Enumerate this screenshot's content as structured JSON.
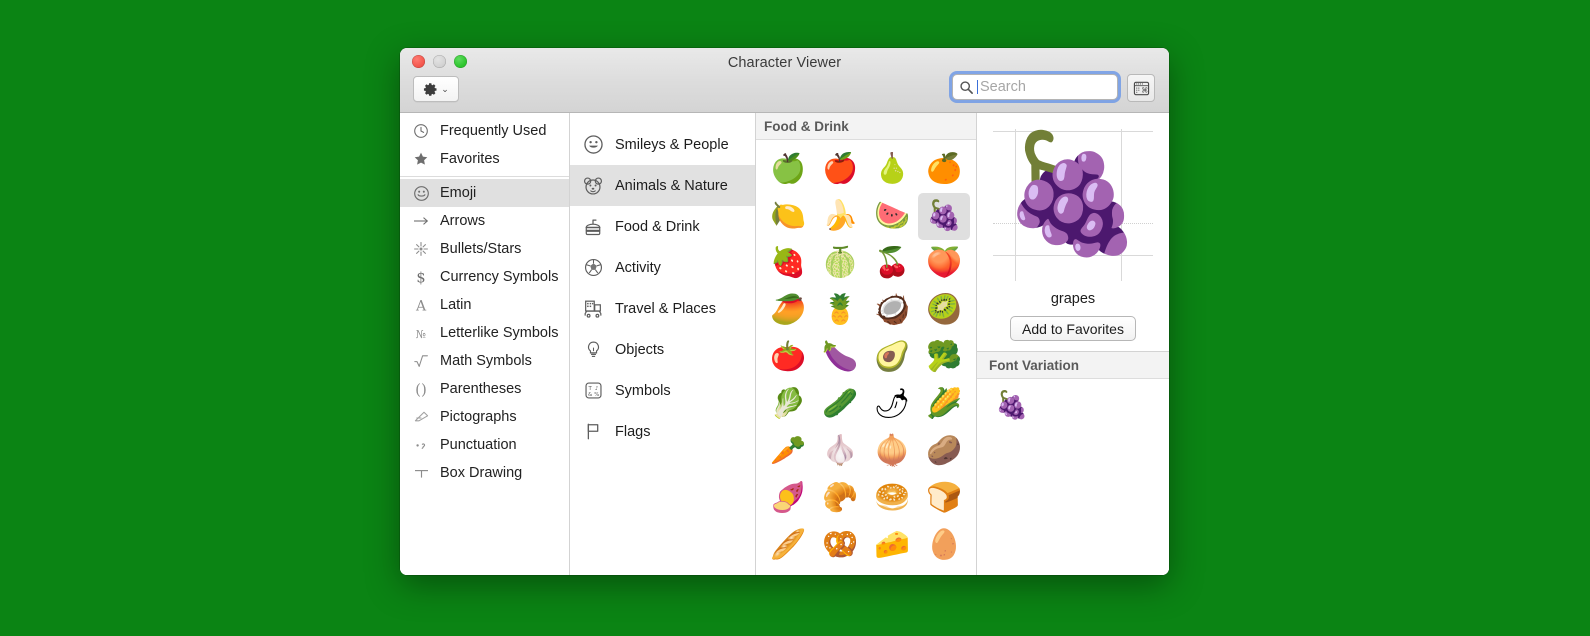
{
  "desktop": {
    "background": "#0b8414"
  },
  "window": {
    "title": "Character Viewer",
    "traffic_lights": [
      {
        "name": "close",
        "color": "#f4594f"
      },
      {
        "name": "minimize",
        "color": "#d3d3d3"
      },
      {
        "name": "zoom",
        "color": "#2fc62f"
      }
    ],
    "toolbar": {
      "gear_button": {
        "icon": "gear-icon",
        "chevron": "⌄"
      },
      "search": {
        "placeholder": "Search",
        "value": "",
        "icon": "search-icon",
        "focused": true
      },
      "palette_button": {
        "icon": "character-palette-icon"
      }
    }
  },
  "sidebar": {
    "items": [
      {
        "label": "Frequently Used",
        "icon": "clock-icon",
        "selected": false
      },
      {
        "label": "Favorites",
        "icon": "star-icon",
        "selected": false
      },
      {
        "label": "Emoji",
        "icon": "smiley-icon",
        "selected": true
      },
      {
        "label": "Arrows",
        "icon": "arrow-right-icon",
        "selected": false
      },
      {
        "label": "Bullets/Stars",
        "icon": "burst-icon",
        "selected": false
      },
      {
        "label": "Currency Symbols",
        "icon": "dollar-icon",
        "selected": false
      },
      {
        "label": "Latin",
        "icon": "letter-a-icon",
        "selected": false
      },
      {
        "label": "Letterlike Symbols",
        "icon": "numero-icon",
        "selected": false
      },
      {
        "label": "Math Symbols",
        "icon": "radical-icon",
        "selected": false
      },
      {
        "label": "Parentheses",
        "icon": "parentheses-icon",
        "selected": false
      },
      {
        "label": "Pictographs",
        "icon": "pictograph-icon",
        "selected": false
      },
      {
        "label": "Punctuation",
        "icon": "punctuation-icon",
        "selected": false
      },
      {
        "label": "Box Drawing",
        "icon": "box-drawing-icon",
        "selected": false
      }
    ],
    "separator_after_index": 1
  },
  "categories": {
    "items": [
      {
        "label": "Smileys & People",
        "icon": "smiley-icon",
        "selected": false
      },
      {
        "label": "Animals & Nature",
        "icon": "bear-icon",
        "selected": true
      },
      {
        "label": "Food & Drink",
        "icon": "sandwich-icon",
        "selected": false
      },
      {
        "label": "Activity",
        "icon": "soccer-ball-icon",
        "selected": false
      },
      {
        "label": "Travel & Places",
        "icon": "car-city-icon",
        "selected": false
      },
      {
        "label": "Objects",
        "icon": "lightbulb-icon",
        "selected": false
      },
      {
        "label": "Symbols",
        "icon": "symbols-grid-icon",
        "selected": false
      },
      {
        "label": "Flags",
        "icon": "flag-icon",
        "selected": false
      }
    ]
  },
  "grid": {
    "section_title": "Food & Drink",
    "selected_index": 7,
    "glyphs": [
      "🍏",
      "🍎",
      "🍐",
      "🍊",
      "🍋",
      "🍌",
      "🍉",
      "🍇",
      "🍓",
      "🍈",
      "🍒",
      "🍑",
      "🥭",
      "🍍",
      "🥥",
      "🥝",
      "🍅",
      "🍆",
      "🥑",
      "🥦",
      "🥬",
      "🥒",
      "🌶",
      "🌽",
      "🥕",
      "🧄",
      "🧅",
      "🥔",
      "🍠",
      "🥐",
      "🥯",
      "🍞",
      "🥖",
      "🥨",
      "🧀",
      "🥚"
    ]
  },
  "detail": {
    "preview_glyph": "🍇",
    "name": "grapes",
    "add_to_favorites_label": "Add to Favorites",
    "font_variation": {
      "title": "Font Variation",
      "variants": [
        "🍇"
      ]
    }
  }
}
